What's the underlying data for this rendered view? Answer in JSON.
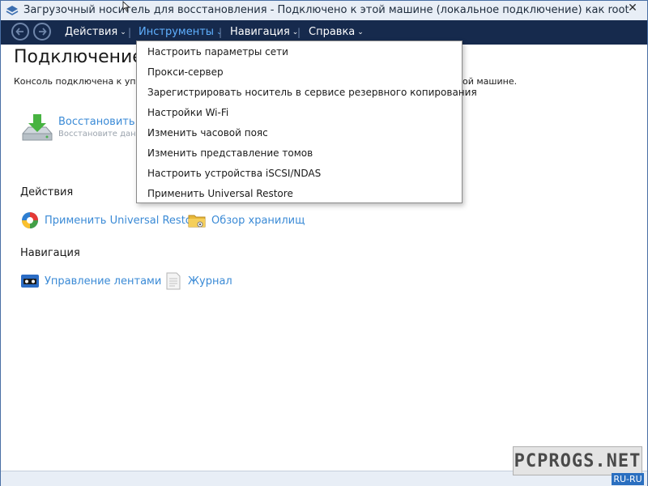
{
  "window": {
    "title": "Загрузочный носитель для восстановления - Подключено к этой машине (локальное подключение) как root",
    "close_glyph": "✕"
  },
  "menubar": {
    "items": [
      {
        "label": "Действия",
        "active": false
      },
      {
        "label": "Инструменты",
        "active": true
      },
      {
        "label": "Навигация",
        "active": false
      },
      {
        "label": "Справка",
        "active": false
      }
    ],
    "separator": "|",
    "chevron": "⌄"
  },
  "page": {
    "title": "Подключение к ’",
    "subtitle": "Консоль подключена к управляем",
    "subtitle_tail": "ой машине.",
    "restore": {
      "label": "Восстановить",
      "description": "Восстановите данные из"
    }
  },
  "dropdown": {
    "items": [
      "Настроить параметры сети",
      "Прокси-сервер",
      "Зарегистрировать носитель в сервисе резервного копирования",
      "Настройки Wi-Fi",
      "Изменить часовой пояс",
      "Изменить представление томов",
      "Настроить устройства iSCSI/NDAS",
      "Применить Universal Restore"
    ]
  },
  "actions": {
    "header": "Действия",
    "items": [
      {
        "label": "Применить Universal Restore",
        "icon": "universal-restore-icon"
      },
      {
        "label": "Обзор хранилищ",
        "icon": "folder-icon"
      }
    ]
  },
  "navigation": {
    "header": "Навигация",
    "items": [
      {
        "label": "Управление лентами",
        "icon": "tape-icon"
      },
      {
        "label": "Журнал",
        "icon": "log-icon"
      }
    ]
  },
  "watermark": {
    "text": "PCPROGS.NET",
    "lang": "RU-RU"
  },
  "colors": {
    "menubar_bg": "#162a4d",
    "link": "#3a8ad6",
    "active_menu": "#5fb0ff"
  }
}
